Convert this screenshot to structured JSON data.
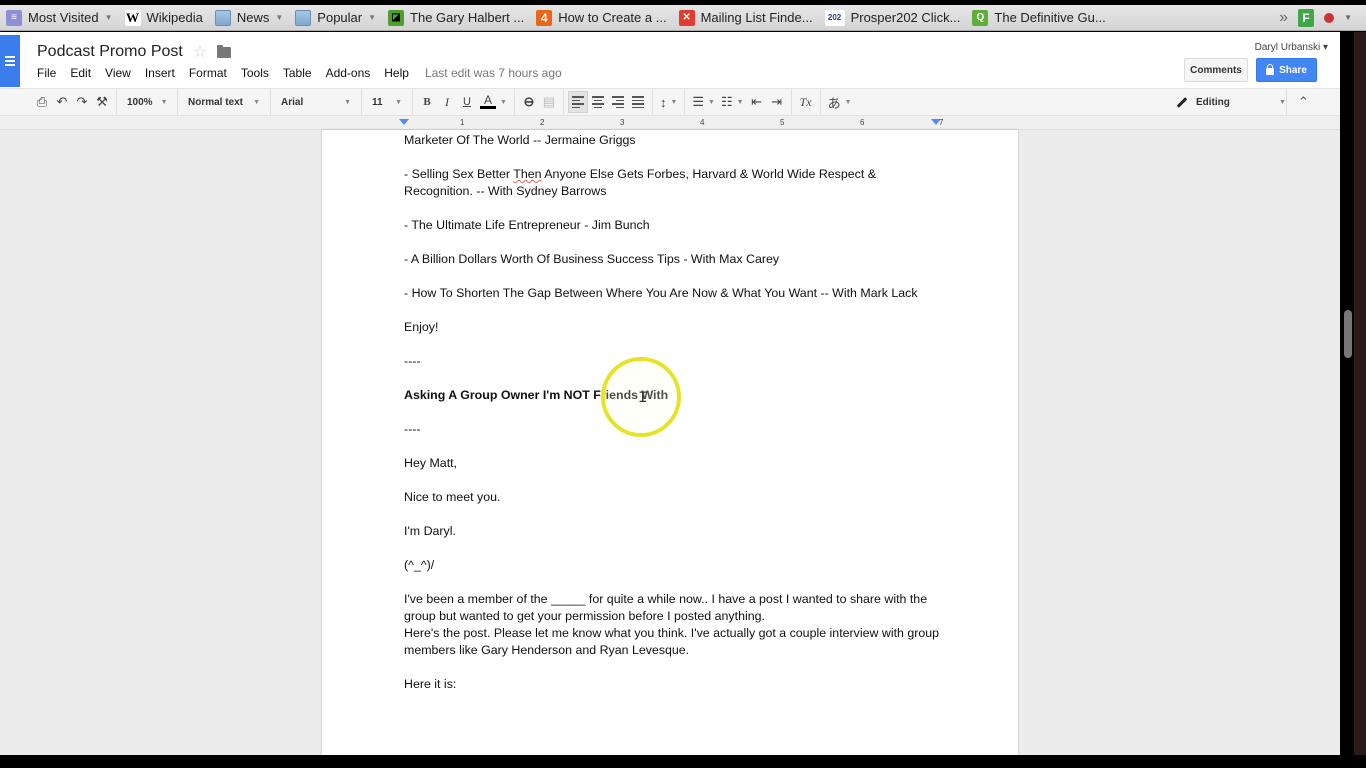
{
  "bookmarks": [
    {
      "label": "Most Visited",
      "icon": "most-visited-icon",
      "dropdown": true
    },
    {
      "label": "Wikipedia",
      "icon": "wikipedia-icon",
      "dropdown": false
    },
    {
      "label": "News",
      "icon": "folder-icon",
      "dropdown": true
    },
    {
      "label": "Popular",
      "icon": "folder-icon",
      "dropdown": true
    },
    {
      "label": "The Gary Halbert ...",
      "icon": "site-icon",
      "dropdown": false
    },
    {
      "label": "How to Create a ...",
      "icon": "site-icon",
      "dropdown": false
    },
    {
      "label": "Mailing List Finde...",
      "icon": "site-icon",
      "dropdown": false
    },
    {
      "label": "Prosper202 Click...",
      "icon": "site-icon",
      "dropdown": false
    },
    {
      "label": "The Definitive Gu...",
      "icon": "site-icon",
      "dropdown": false
    }
  ],
  "bookmark_icons": {
    "wiki": "W",
    "four": "4",
    "p202": "202",
    "q": "Q",
    "f": "F"
  },
  "overflow_label": "»",
  "doc": {
    "title": "Podcast Promo Post",
    "menu": [
      "File",
      "Edit",
      "View",
      "Insert",
      "Format",
      "Tools",
      "Table",
      "Add-ons",
      "Help"
    ],
    "last_edit": "Last edit was 7 hours ago",
    "user": "Daryl Urbanski ▾",
    "comments_label": "Comments",
    "share_label": "Share"
  },
  "toolbar": {
    "zoom": "100%",
    "style": "Normal text",
    "font": "Arial",
    "size": "11",
    "bold": "B",
    "italic": "I",
    "underline": "U",
    "text_color": "A",
    "clear_format": "Tx",
    "input_tools": "あ",
    "mode": "Editing"
  },
  "ruler": {
    "numbers": [
      "1",
      "2",
      "3",
      "4",
      "5",
      "6",
      "7"
    ]
  },
  "content": {
    "p1": "Marketer Of The World -- Jermaine Griggs",
    "p2_pre": "- Selling Sex Better ",
    "p2_spell": "Then",
    "p2_post": " Anyone Else Gets Forbes, Harvard & World Wide Respect & Recognition. -- With Sydney Barrows",
    "p3": "- The Ultimate Life Entrepreneur - Jim Bunch",
    "p4": "- A Billion Dollars Worth Of Business Success Tips - With Max Carey",
    "p5": "- How To Shorten The Gap Between Where You Are Now & What You Want -- With Mark Lack",
    "p6": "Enjoy!",
    "p7": "----",
    "p8": "Asking A Group Owner I'm NOT Friends With",
    "p9": "----",
    "p10": "Hey Matt,",
    "p11": "Nice to meet you.",
    "p12": "I'm Daryl.",
    "p13": "(^_^)/",
    "p14": "I've been a member of the _____ for quite a while now.. I have a post I wanted to share with the group but wanted to get your permission before I posted anything.",
    "p15": "Here's the post. Please let me know what you think. I've actually got a couple interview with group members like Gary Henderson and Ryan Levesque.",
    "p16": "Here it is:"
  }
}
